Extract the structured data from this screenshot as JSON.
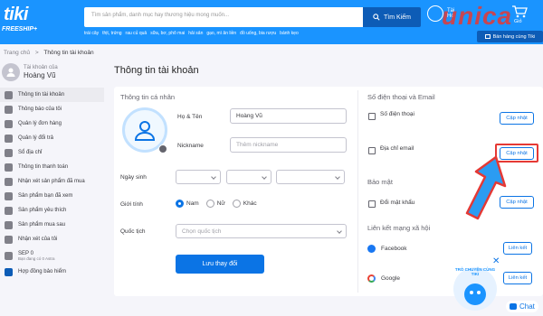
{
  "header": {
    "logo": "tiki",
    "freeship": "FREESHIP",
    "search_placeholder": "Tìm sản phẩm, danh mục hay thương hiệu mong muốn...",
    "search_button": "Tìm Kiếm",
    "quick_links": [
      "trái cây",
      "thịt, trứng",
      "rau củ quả",
      "sữa, bơ, phô mai",
      "hải sản",
      "gạo, mì ăn liền",
      "đồ uống, bia rượu",
      "bánh kẹo"
    ],
    "user_line1": "Tài",
    "user_line2": "Ho",
    "watermark": "unica",
    "cart_label": "Giỏ",
    "seller_button": "Bán hàng cùng Tiki"
  },
  "breadcrumb": {
    "home": "Trang chủ",
    "sep": ">",
    "current": "Thông tin tài khoản"
  },
  "profile": {
    "label": "Tài khoản của",
    "name": "Hoàng Vũ"
  },
  "sidebar": {
    "items": [
      {
        "label": "Thông tin tài khoản",
        "icon": "user-icon"
      },
      {
        "label": "Thông báo của tôi",
        "icon": "bell-icon"
      },
      {
        "label": "Quản lý đơn hàng",
        "icon": "list-icon"
      },
      {
        "label": "Quản lý đổi trả",
        "icon": "return-icon"
      },
      {
        "label": "Sổ địa chỉ",
        "icon": "pin-icon"
      },
      {
        "label": "Thông tin thanh toán",
        "icon": "card-icon"
      },
      {
        "label": "Nhận xét sản phẩm đã mua",
        "icon": "review-icon"
      },
      {
        "label": "Sản phẩm bạn đã xem",
        "icon": "eye-icon"
      },
      {
        "label": "Sản phẩm yêu thích",
        "icon": "heart-icon"
      },
      {
        "label": "Sản phẩm mua sau",
        "icon": "bag-icon"
      },
      {
        "label": "Nhận xét của tôi",
        "icon": "star-icon"
      }
    ],
    "sep_title": "SEP 0",
    "sep_sub": "Bạn đang có 0 Astra",
    "insurance": "Hợp đồng bảo hiểm"
  },
  "main": {
    "title": "Thông tin tài khoản",
    "personal_section": "Thông tin cá nhân",
    "fullname_label": "Họ & Tên",
    "fullname_value": "Hoàng Vũ",
    "nickname_label": "Nickname",
    "nickname_placeholder": "Thêm nickname",
    "birthday_label": "Ngày sinh",
    "gender_label": "Giới tính",
    "gender_options": [
      "Nam",
      "Nữ",
      "Khác"
    ],
    "nationality_label": "Quốc tịch",
    "nationality_placeholder": "Chọn quốc tịch",
    "save_button": "Lưu thay đổi"
  },
  "right": {
    "contact_section": "Số điện thoại và Email",
    "phone_label": "Số điện thoại",
    "email_label": "Địa chỉ email",
    "update_button": "Cập nhật",
    "security_section": "Bảo mật",
    "password_label": "Đổi mật khẩu",
    "social_section": "Liên kết mạng xã hội",
    "facebook_label": "Facebook",
    "google_label": "Google",
    "link_button": "Liên kết"
  },
  "chat": {
    "bubble_text": "TRÒ CHUYỆN CÙNG TIKI",
    "close": "✕",
    "button": "Chat"
  },
  "colors": {
    "header_blue": "#1a94ff",
    "primary": "#0b74e5",
    "highlight_red": "#e53935",
    "arrow_blue": "#2b9cf2"
  }
}
